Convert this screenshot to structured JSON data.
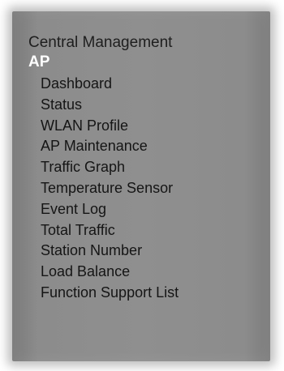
{
  "menu": {
    "heading": "Central Management",
    "section": "AP",
    "items": [
      {
        "label": "Dashboard"
      },
      {
        "label": "Status"
      },
      {
        "label": "WLAN Profile"
      },
      {
        "label": "AP Maintenance"
      },
      {
        "label": "Traffic Graph"
      },
      {
        "label": "Temperature Sensor"
      },
      {
        "label": "Event Log"
      },
      {
        "label": "Total Traffic"
      },
      {
        "label": "Station Number"
      },
      {
        "label": "Load Balance"
      },
      {
        "label": "Function Support List"
      }
    ]
  }
}
